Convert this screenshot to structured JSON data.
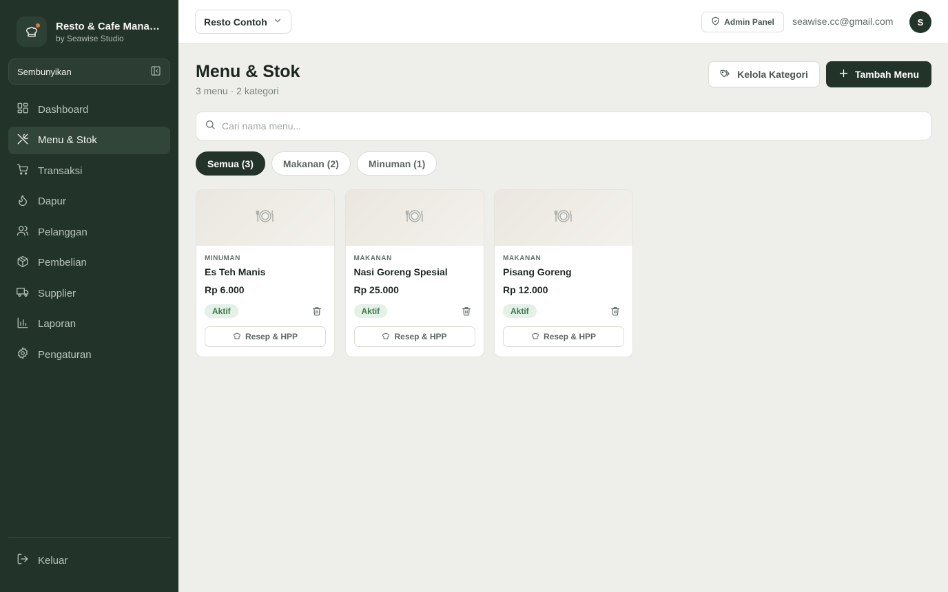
{
  "app": {
    "title": "Resto & Cafe Manag...",
    "subtitle": "by Seawise Studio"
  },
  "sidebar": {
    "collapse_label": "Sembunyikan",
    "items": [
      {
        "label": "Dashboard",
        "icon": "dashboard-icon",
        "active": false
      },
      {
        "label": "Menu & Stok",
        "icon": "utensils-icon",
        "active": true
      },
      {
        "label": "Transaksi",
        "icon": "cart-icon",
        "active": false
      },
      {
        "label": "Dapur",
        "icon": "flame-icon",
        "active": false
      },
      {
        "label": "Pelanggan",
        "icon": "users-icon",
        "active": false
      },
      {
        "label": "Pembelian",
        "icon": "package-icon",
        "active": false
      },
      {
        "label": "Supplier",
        "icon": "truck-icon",
        "active": false
      },
      {
        "label": "Laporan",
        "icon": "bar-chart-icon",
        "active": false
      },
      {
        "label": "Pengaturan",
        "icon": "gear-icon",
        "active": false
      }
    ],
    "logout_label": "Keluar"
  },
  "topbar": {
    "restaurant": "Resto Contoh",
    "admin_label": "Admin Panel",
    "email": "seawise.cc@gmail.com",
    "avatar_initial": "S"
  },
  "page": {
    "title": "Menu & Stok",
    "subtitle": "3 menu · 2 kategori",
    "manage_categories_label": "Kelola Kategori",
    "add_menu_label": "Tambah Menu"
  },
  "search": {
    "placeholder": "Cari nama menu...",
    "value": ""
  },
  "filters": [
    {
      "label": "Semua (3)",
      "active": true
    },
    {
      "label": "Makanan (2)",
      "active": false
    },
    {
      "label": "Minuman (1)",
      "active": false
    }
  ],
  "menu_items": [
    {
      "category": "MINUMAN",
      "name": "Es Teh Manis",
      "price": "Rp 6.000",
      "status": "Aktif",
      "recipe_label": "Resep & HPP",
      "image_icon": "plate-icon"
    },
    {
      "category": "MAKANAN",
      "name": "Nasi Goreng Spesial",
      "price": "Rp 25.000",
      "status": "Aktif",
      "recipe_label": "Resep & HPP",
      "image_icon": "plate-icon"
    },
    {
      "category": "MAKANAN",
      "name": "Pisang Goreng",
      "price": "Rp 12.000",
      "status": "Aktif",
      "recipe_label": "Resep & HPP",
      "image_icon": "plate-icon"
    }
  ],
  "colors": {
    "sidebar_bg": "#22332a",
    "primary": "#22332a",
    "active_badge_bg": "#e3f1e6",
    "active_badge_text": "#3f7a50",
    "logo_dot": "#e07a3a"
  }
}
